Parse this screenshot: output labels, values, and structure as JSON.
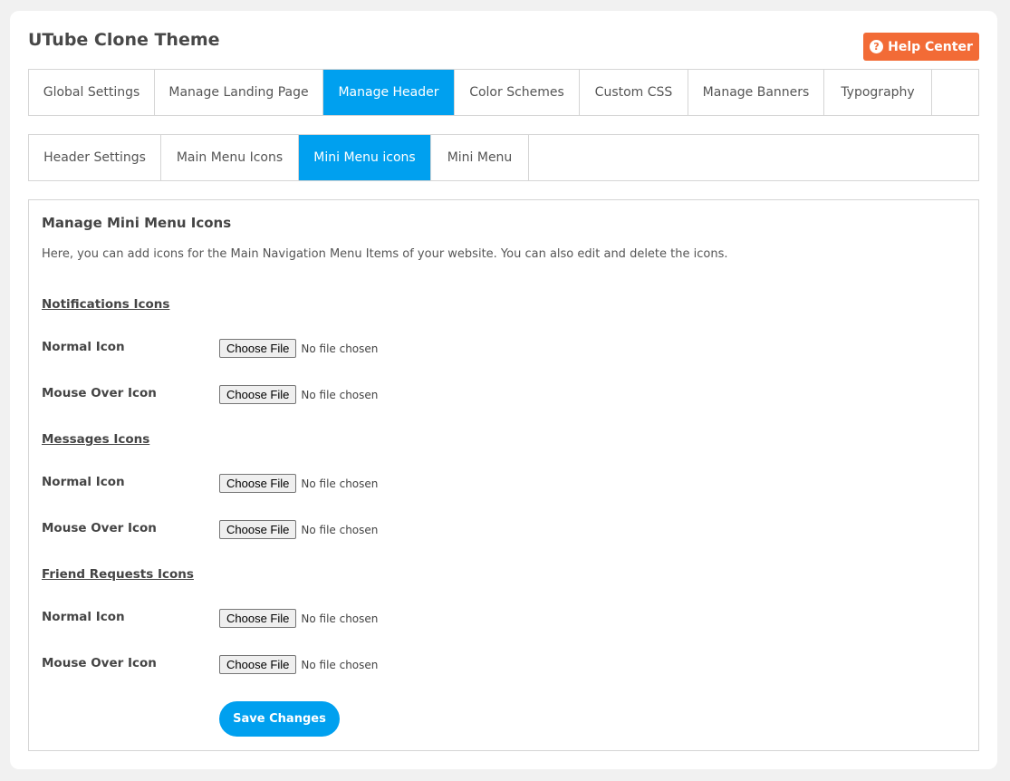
{
  "app": {
    "title": "UTube Clone Theme",
    "help_label": "Help Center",
    "help_icon": "question-circle-icon"
  },
  "main_tabs": [
    "Global Settings",
    "Manage Landing Page",
    "Manage Header",
    "Color Schemes",
    "Custom CSS",
    "Manage Banners",
    "Typography"
  ],
  "sub_tabs": [
    "Header Settings",
    "Main Menu Icons",
    "Mini Menu icons",
    "Mini Menu"
  ],
  "panel": {
    "title": "Manage Mini Menu Icons",
    "description": "Here, you can add icons for the Main Navigation Menu Items of your website. You can also edit and delete the icons."
  },
  "sections": [
    {
      "heading": "Notifications Icons",
      "fields": [
        {
          "label": "Normal Icon",
          "button": "Choose File",
          "status": "No file chosen"
        },
        {
          "label": "Mouse Over Icon",
          "button": "Choose File",
          "status": "No file chosen"
        }
      ]
    },
    {
      "heading": "Messages Icons",
      "fields": [
        {
          "label": "Normal Icon",
          "button": "Choose File",
          "status": "No file chosen"
        },
        {
          "label": "Mouse Over Icon",
          "button": "Choose File",
          "status": "No file chosen"
        }
      ]
    },
    {
      "heading": "Friend Requests Icons",
      "fields": [
        {
          "label": "Normal Icon",
          "button": "Choose File",
          "status": "No file chosen"
        },
        {
          "label": "Mouse Over Icon",
          "button": "Choose File",
          "status": "No file chosen"
        }
      ]
    }
  ],
  "save_label": "Save Changes",
  "colors": {
    "accent": "#00a0ef",
    "help": "#f26b36"
  }
}
